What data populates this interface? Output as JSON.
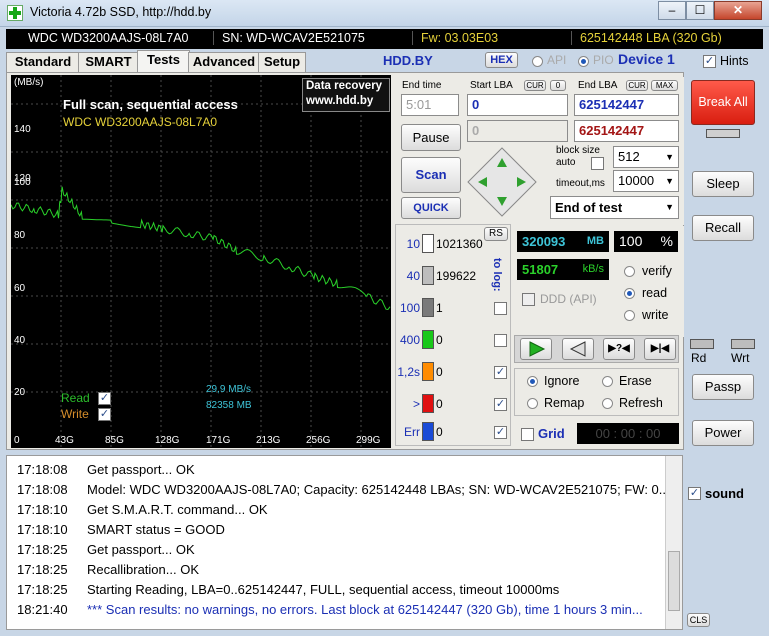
{
  "window": {
    "title": "Victoria 4.72b SSD, http://hdd.by",
    "min": "–",
    "max": "☐",
    "close": "✕"
  },
  "info": {
    "model": "WDC WD3200AAJS-08L7A0",
    "serial": "SN: WD-WCAV2E521075",
    "firmware": "Fw: 03.03E03",
    "capacity": "625142448 LBA (320 Gb)"
  },
  "tabs": [
    "Standard",
    "SMART",
    "Tests",
    "Advanced",
    "Setup"
  ],
  "header": {
    "site": "HDD.BY",
    "hex": "HEX",
    "api": "API",
    "pio": "PIO",
    "device": "Device 1",
    "hints": "Hints"
  },
  "graph": {
    "unit": "(MB/s)",
    "y_ticks": [
      "140",
      "120",
      "100",
      "80",
      "60",
      "40",
      "20"
    ],
    "x_ticks": [
      "0",
      "43G",
      "85G",
      "128G",
      "171G",
      "213G",
      "256G",
      "299G"
    ],
    "title": "Full scan, sequential access",
    "model": "WDC WD3200AAJS-08L7A0",
    "recovery_line1": "Data recovery",
    "recovery_line2": "www.hdd.by",
    "read_label": "Read",
    "write_label": "Write",
    "speed": "29,9 MB/s",
    "speed_lba": "82358 MB"
  },
  "chart_data": {
    "type": "line",
    "ylabel": "(MB/s)",
    "ylim": [
      0,
      150
    ],
    "x_ticks": [
      "0",
      "43G",
      "85G",
      "128G",
      "171G",
      "213G",
      "256G",
      "299G"
    ],
    "series": [
      {
        "name": "Read",
        "x_gb": [
          0,
          20,
          40,
          43,
          60,
          85,
          110,
          128,
          150,
          171,
          190,
          213,
          235,
          256,
          275,
          299,
          320
        ],
        "y": [
          98,
          96,
          94,
          104,
          93,
          91,
          90,
          88,
          86,
          84,
          79,
          76,
          72,
          68,
          65,
          60,
          55
        ]
      }
    ]
  },
  "controls": {
    "end_time_label": "End time",
    "end_time": "5:01",
    "start_lba_label": "Start LBA",
    "cur": "CUR",
    "zero": "0",
    "end_lba_label": "End LBA",
    "max": "MAX",
    "start_lba": "0",
    "end_lba": "625142447",
    "start_lba2": "0",
    "end_lba2": "625142447",
    "pause": "Pause",
    "scan": "Scan",
    "quick": "QUICK",
    "block_size_label": "block size",
    "auto_label": "auto",
    "block_size": "512",
    "timeout_label": "timeout,ms",
    "timeout": "10000",
    "end_of_test": "End of test",
    "break_all": "Break All",
    "sleep": "Sleep",
    "recall": "Recall",
    "rd": "Rd",
    "wrt": "Wrt",
    "passp": "Passp",
    "power": "Power"
  },
  "stats": {
    "rs": "RS",
    "to_log": "to log:",
    "rows": [
      {
        "label": "10",
        "count": "1021360",
        "color": "#ffffff"
      },
      {
        "label": "40",
        "count": "199622",
        "color": "#bdbdbd"
      },
      {
        "label": "100",
        "count": "1",
        "color": "#7a7a7a"
      },
      {
        "label": "400",
        "count": "0",
        "color": "#19c819"
      },
      {
        "label": "1,2s",
        "count": "0",
        "color": "#ff8c00"
      },
      {
        "label": ">",
        "count": "0",
        "color": "#e01010"
      },
      {
        "label": "Err",
        "count": "0",
        "color": "#1a4bd6"
      }
    ],
    "mb_done": "320093",
    "mb_unit": "MB",
    "percent": "100",
    "percent_unit": "%",
    "speed": "51807",
    "speed_unit": "kB/s",
    "ddd": "DDD (API)",
    "verify": "verify",
    "read": "read",
    "write": "write",
    "ignore": "Ignore",
    "erase": "Erase",
    "remap": "Remap",
    "refresh": "Refresh",
    "grid": "Grid",
    "grid_time": "00 : 00 : 00"
  },
  "log": [
    {
      "time": "17:18:08",
      "msg": "Get passport... OK"
    },
    {
      "time": "17:18:08",
      "msg": "Model: WDC WD3200AAJS-08L7A0; Capacity: 625142448 LBAs; SN: WD-WCAV2E521075; FW: 0..."
    },
    {
      "time": "17:18:10",
      "msg": "Get S.M.A.R.T. command... OK"
    },
    {
      "time": "17:18:10",
      "msg": "SMART status = GOOD"
    },
    {
      "time": "17:18:25",
      "msg": "Get passport... OK"
    },
    {
      "time": "17:18:25",
      "msg": "Recallibration... OK"
    },
    {
      "time": "17:18:25",
      "msg": "Starting Reading, LBA=0..625142447, FULL, sequential access, timeout 10000ms"
    },
    {
      "time": "18:21:40",
      "msg": "*** Scan results: no warnings, no errors. Last block at 625142447 (320 Gb), time 1 hours 3 min..."
    }
  ],
  "sound": "sound",
  "cls": "CLS"
}
